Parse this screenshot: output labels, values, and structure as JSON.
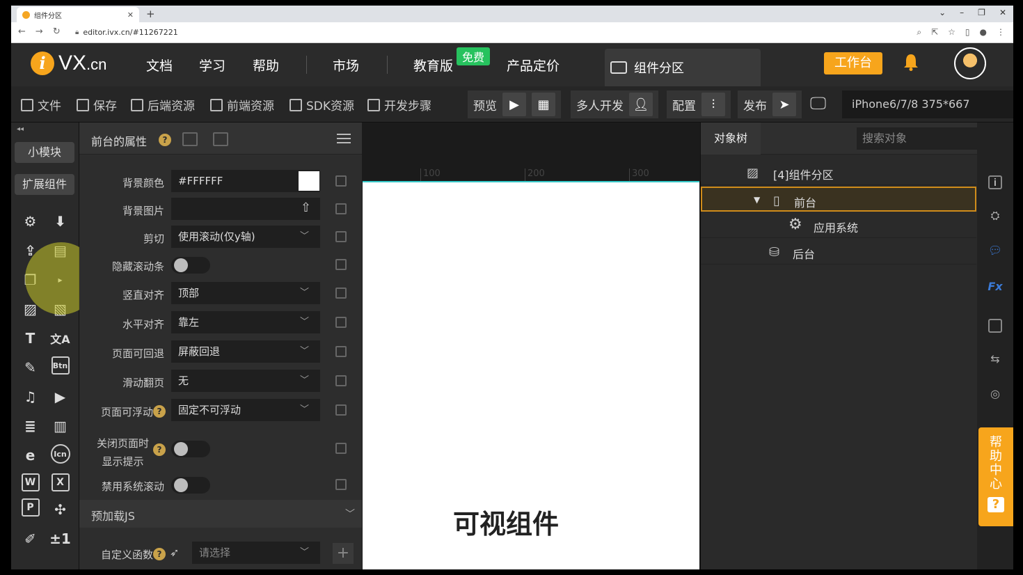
{
  "browser": {
    "tab_title": "组件分区",
    "url": "editor.ivx.cn/#11267221",
    "tab_close": "✕",
    "new_tab": "+"
  },
  "header": {
    "logo_letter": "i",
    "logo_text": "VX",
    "logo_suffix": ".cn",
    "nav": [
      "文档",
      "学习",
      "帮助",
      "市场",
      "教育版",
      "产品定价"
    ],
    "free_badge": "免费",
    "active_tab": "组件分区",
    "workbench_button": "工作台"
  },
  "toolbar": {
    "file": "文件",
    "save": "保存",
    "backend": "后端资源",
    "frontend": "前端资源",
    "sdk": "SDK资源",
    "steps": "开发步骤",
    "preview": "预览",
    "multi_dev": "多人开发",
    "config": "配置",
    "publish": "发布",
    "device": "iPhone6/7/8 375*667"
  },
  "leftcol": {
    "collapse": "◂◂",
    "small_module": "小模块",
    "extend_components": "扩展组件",
    "icons": [
      "gear-icon",
      "download-icon",
      "upload-file-icon",
      "layout-icon",
      "copy-icon",
      "cursor-icon",
      "image-icon",
      "image-frame-icon",
      "text-icon",
      "translate-icon",
      "edit-icon",
      "btn-icon",
      "music-icon",
      "video-icon",
      "list-icon",
      "card-icon",
      "ie-icon",
      "icon-font-icon",
      "word-icon",
      "excel-icon",
      "ppt-icon",
      "puzzle-icon",
      "brush-icon",
      "plus-minus-icon"
    ],
    "icon_glyphs": [
      "⚙",
      "⬇",
      "⇪",
      "▤",
      "❐",
      "",
      "▨",
      "▧",
      "T",
      "文A",
      "✎",
      "Btn",
      "♫",
      "▶",
      "≣",
      "▥",
      "e",
      "Icn",
      "W",
      "X",
      "P",
      "✣",
      "✐",
      "±1"
    ]
  },
  "properties": {
    "title": "前台的属性",
    "help": "?",
    "rows": [
      {
        "label": "背景颜色",
        "value": "#FFFFFF"
      },
      {
        "label": "背景图片",
        "value": ""
      },
      {
        "label": "剪切",
        "value": "使用滚动(仅y轴)"
      },
      {
        "label": "隐藏滚动条",
        "value": ""
      },
      {
        "label": "竖直对齐",
        "value": "顶部"
      },
      {
        "label": "水平对齐",
        "value": "靠左"
      },
      {
        "label": "页面可回退",
        "value": "屏蔽回退"
      },
      {
        "label": "滑动翻页",
        "value": "无"
      },
      {
        "label": "页面可浮动",
        "value": "固定不可浮动"
      },
      {
        "label_line1": "关闭页面时",
        "label_line2": "显示提示",
        "value": ""
      },
      {
        "label": "禁用系统滚动",
        "value": ""
      }
    ],
    "section_preload": "预加载JS",
    "custom_function_label": "自定义函数",
    "custom_function_placeholder": "请选择",
    "plus": "+"
  },
  "canvas": {
    "ruler": [
      "100",
      "200",
      "300"
    ],
    "visible_text": "可视组件"
  },
  "tree": {
    "tab": "对象树",
    "search_placeholder": "搜索对象",
    "nodes": [
      "[4]组件分区",
      "前台",
      "应用系统",
      "后台"
    ]
  },
  "rightstrip": {
    "help_center": "帮助中心",
    "help_q": "?"
  },
  "colors": {
    "accent": "#f7a51c",
    "free_badge": "#27c25e",
    "selection_border": "#d08c1a"
  }
}
